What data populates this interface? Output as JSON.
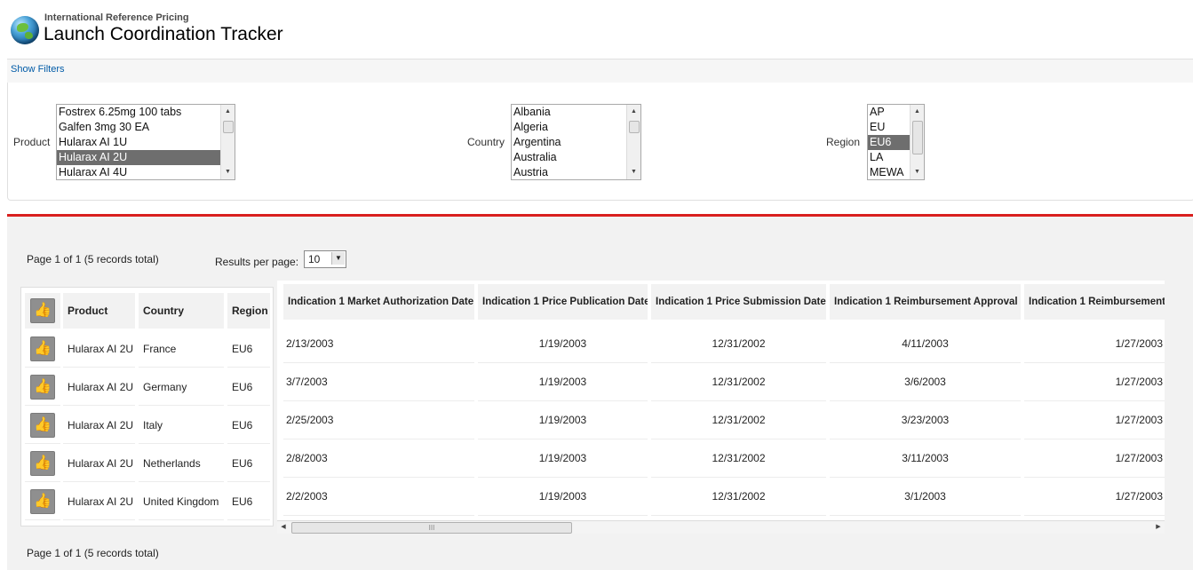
{
  "header": {
    "subtitle": "International Reference Pricing",
    "title": "Launch Coordination Tracker",
    "icon": "globe-icon"
  },
  "filter_toggle": "Show Filters",
  "filters": {
    "product": {
      "label": "Product",
      "options": [
        "Fostrex 6.25mg 100 tabs",
        "Galfen 3mg 30 EA",
        "Hularax AI 1U",
        "Hularax AI 2U",
        "Hularax AI 4U"
      ],
      "selected": "Hularax AI 2U"
    },
    "country": {
      "label": "Country",
      "options": [
        "Albania",
        "Algeria",
        "Argentina",
        "Australia",
        "Austria"
      ],
      "selected": ""
    },
    "region": {
      "label": "Region",
      "options": [
        "AP",
        "EU",
        "EU6",
        "LA",
        "MEWA"
      ],
      "selected": "EU6"
    }
  },
  "pagination": {
    "info_top": "Page 1 of 1 (5 records total)",
    "info_bottom": "Page 1 of 1 (5 records total)",
    "results_per_page_label": "Results per page:",
    "results_per_page_value": "10"
  },
  "left_table": {
    "columns": [
      "Product",
      "Country",
      "Region"
    ],
    "rows": [
      {
        "product": "Hularax AI 2U",
        "country": "France",
        "region": "EU6"
      },
      {
        "product": "Hularax AI 2U",
        "country": "Germany",
        "region": "EU6"
      },
      {
        "product": "Hularax AI 2U",
        "country": "Italy",
        "region": "EU6"
      },
      {
        "product": "Hularax AI 2U",
        "country": "Netherlands",
        "region": "EU6"
      },
      {
        "product": "Hularax AI 2U",
        "country": "United Kingdom",
        "region": "EU6"
      }
    ]
  },
  "right_table": {
    "columns": [
      "Indication 1 Market Authorization Date",
      "Indication 1 Price Publication Date",
      "Indication 1 Price Submission Date",
      "Indication 1 Reimbursement Approval",
      "Indication 1 Reimbursement"
    ],
    "rows": [
      [
        "2/13/2003",
        "1/19/2003",
        "12/31/2002",
        "4/11/2003",
        "1/27/2003"
      ],
      [
        "3/7/2003",
        "1/19/2003",
        "12/31/2002",
        "3/6/2003",
        "1/27/2003"
      ],
      [
        "2/25/2003",
        "1/19/2003",
        "12/31/2002",
        "3/23/2003",
        "1/27/2003"
      ],
      [
        "2/8/2003",
        "1/19/2003",
        "12/31/2002",
        "3/11/2003",
        "1/27/2003"
      ],
      [
        "2/2/2003",
        "1/19/2003",
        "12/31/2002",
        "3/1/2003",
        "1/27/2003"
      ]
    ]
  },
  "colors": {
    "accent_red": "#d9201f",
    "link_blue": "#015ba7",
    "selection_gray": "#6e6e6e"
  }
}
